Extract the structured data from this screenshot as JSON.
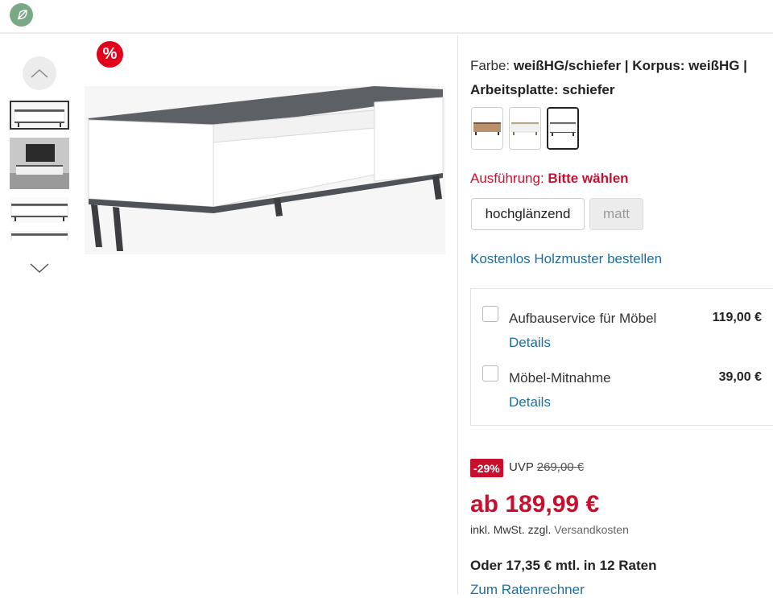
{
  "gallery": {
    "sale_badge": "%"
  },
  "variant": {
    "farbe_label": "Farbe:",
    "farbe_value": "weißHG/schiefer | Korpus: weißHG | Arbeitsplatte: schiefer"
  },
  "ausfuehrung": {
    "label": "Ausführung:",
    "value": "Bitte wählen",
    "options": [
      "hochglänzend",
      "matt"
    ]
  },
  "links": {
    "holzmuster": "Kostenlos Holzmuster bestellen",
    "ratenrechner": "Zum Ratenrechner"
  },
  "services": [
    {
      "name": "Aufbauservice für Möbel",
      "price": "119,00 €",
      "details": "Details"
    },
    {
      "name": "Möbel-Mitnahme",
      "price": "39,00 €",
      "details": "Details"
    }
  ],
  "pricing": {
    "discount": "-29%",
    "uvp_label": "UVP",
    "uvp_value": "269,00 €",
    "price": "ab 189,99 €",
    "tax_prefix": "inkl. MwSt. zzgl.",
    "tax_link": "Versandkosten",
    "rate": "Oder 17,35 € mtl. in 12 Raten"
  },
  "colors": {
    "accent_red": "#c8102e",
    "link_blue": "#1e6f9f"
  }
}
